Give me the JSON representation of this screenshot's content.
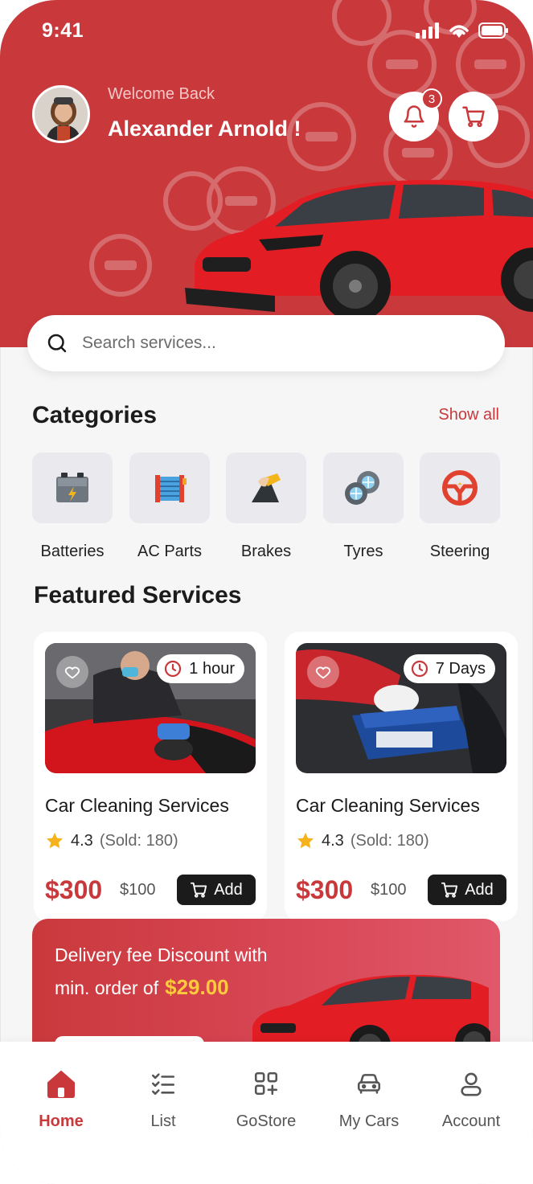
{
  "status_bar": {
    "time": "9:41"
  },
  "header": {
    "welcome": "Welcome Back",
    "username": "Alexander Arnold !",
    "notification_count": "3"
  },
  "search": {
    "placeholder": "Search services..."
  },
  "categories": {
    "title": "Categories",
    "show_all": "Show all",
    "items": [
      {
        "label": "Batteries",
        "icon": "battery-icon"
      },
      {
        "label": "AC Parts",
        "icon": "ac-parts-icon"
      },
      {
        "label": "Brakes",
        "icon": "brake-icon"
      },
      {
        "label": "Tyres",
        "icon": "tyres-icon"
      },
      {
        "label": "Steering",
        "icon": "steering-wheel-icon"
      }
    ]
  },
  "featured": {
    "title": "Featured Services",
    "cards": [
      {
        "duration": "1 hour",
        "title": "Car Cleaning Services",
        "rating": "4.3",
        "sold": "(Sold: 180)",
        "price": "$300",
        "old_price": "$100",
        "add_label": "Add"
      },
      {
        "duration": "7 Days",
        "title": "Car Cleaning Services",
        "rating": "4.3",
        "sold": "(Sold: 180)",
        "price": "$300",
        "old_price": "$100",
        "add_label": "Add"
      }
    ]
  },
  "promo": {
    "line1": "Delivery fee Discount with",
    "line2": "min. order of",
    "amount": "$29.00"
  },
  "nav": {
    "items": [
      {
        "label": "Home",
        "icon": "home-icon",
        "active": true
      },
      {
        "label": "List",
        "icon": "checklist-icon"
      },
      {
        "label": "GoStore",
        "icon": "store-grid-icon"
      },
      {
        "label": "My Cars",
        "icon": "car-icon"
      },
      {
        "label": "Account",
        "icon": "user-icon"
      }
    ]
  },
  "colors": {
    "brand": "#c9393c",
    "price": "#c9393c",
    "promo_amount": "#ffc93e"
  }
}
